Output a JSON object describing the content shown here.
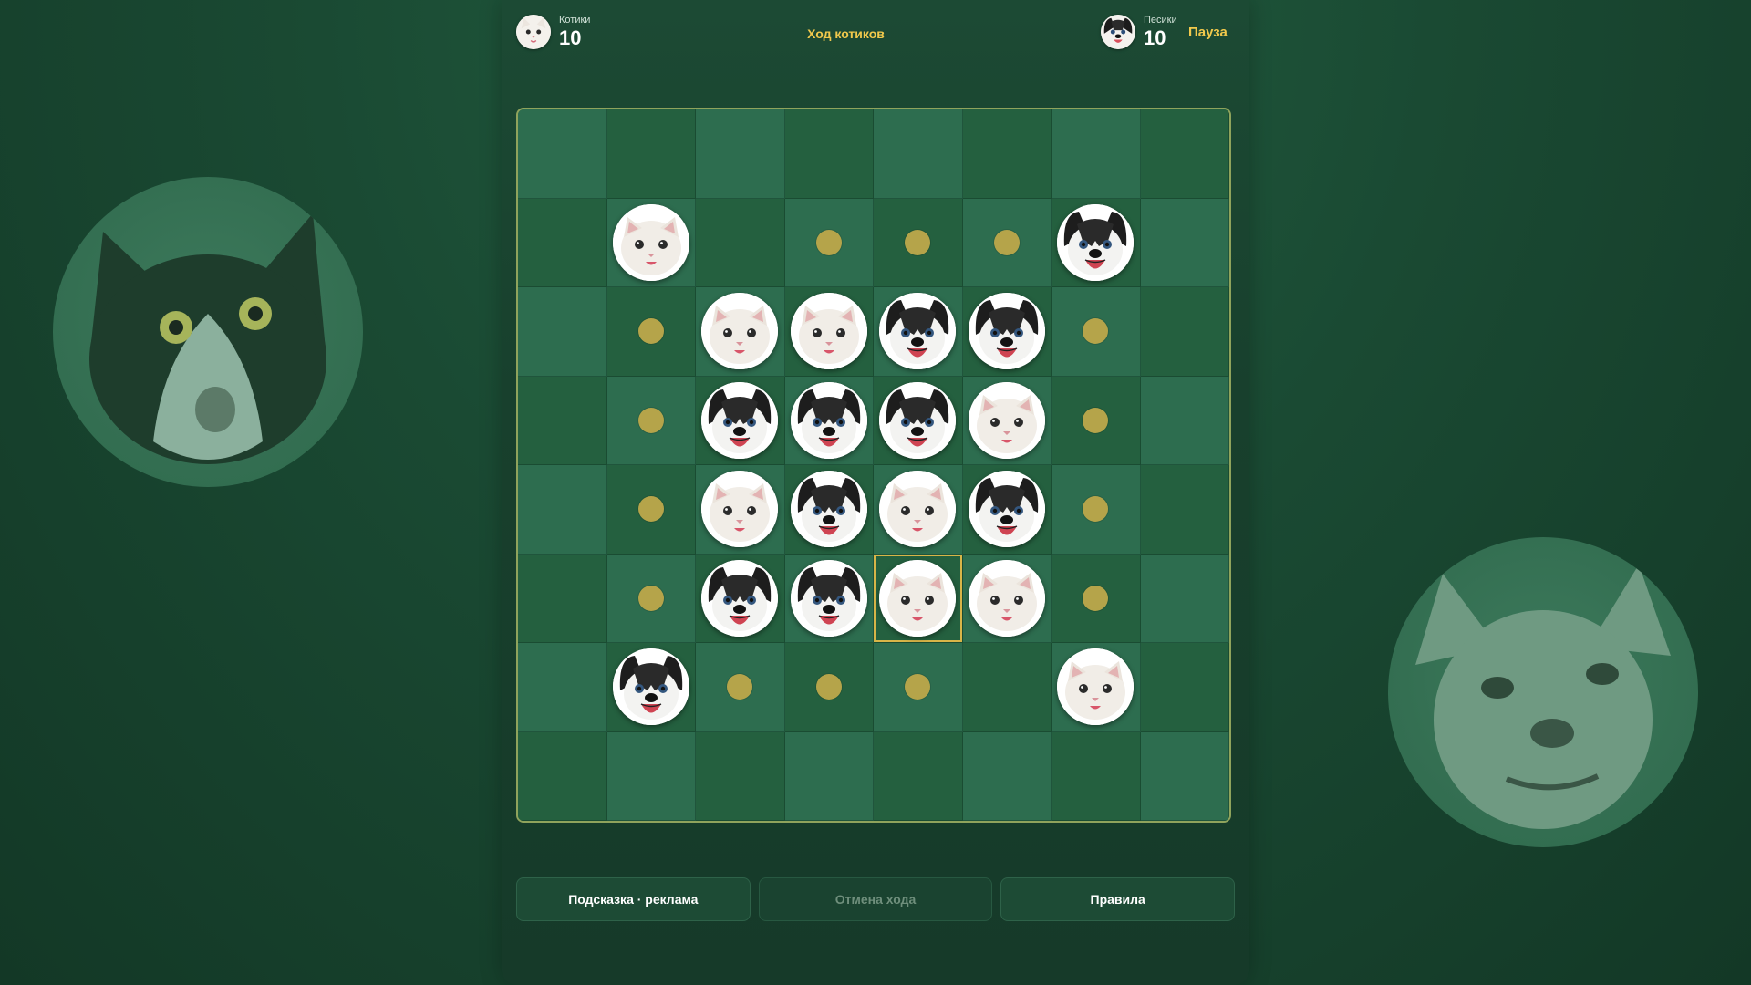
{
  "hud": {
    "cats": {
      "name": "Котики",
      "score": "10",
      "icon": "cat-avatar-icon"
    },
    "dogs": {
      "name": "Песики",
      "score": "10",
      "icon": "dog-avatar-icon"
    },
    "turn_text": "Ход котиков",
    "pause_label": "Пауза"
  },
  "board": {
    "size": 8,
    "legend": {
      "C": "cat-piece",
      "D": "dog-piece",
      "*": "valid-move-hint",
      ".": "empty"
    },
    "rows": [
      "........",
      ".C.***D.",
      ".*CCDD*.",
      ".*DDDC*.",
      ".*CDCD*.",
      ".*DDCC*.",
      ".D***.C.",
      "........"
    ],
    "selected": {
      "row": 5,
      "col": 4
    }
  },
  "controls": {
    "hint_label": "Подсказка · реклама",
    "undo_label": "Отмена хода",
    "rules_label": "Правила"
  },
  "colors": {
    "accent": "#f2c94c",
    "hint_dot": "#b5a44a",
    "board_light": "#2d6d4f",
    "board_dark": "#24603f",
    "border": "#8fa35c"
  }
}
